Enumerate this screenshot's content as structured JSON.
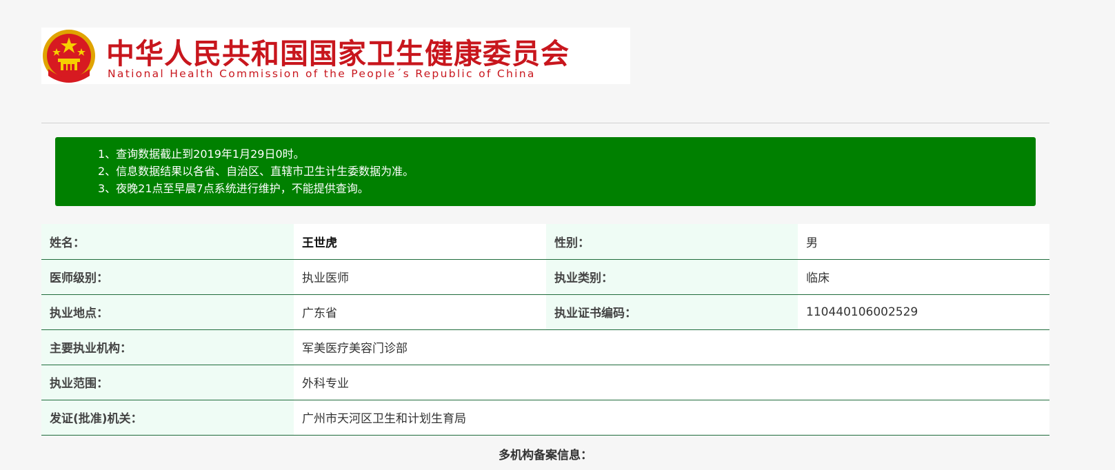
{
  "header": {
    "title_cn": "中华人民共和国国家卫生健康委员会",
    "title_en": "National Health Commission of the People´s Republic of China",
    "emblem_icon": "national-emblem-icon",
    "brand_color": "#c8161d"
  },
  "notice": {
    "background_color": "#008000",
    "lines": [
      "1、查询数据截止到2019年1月29日0时。",
      "2、信息数据结果以各省、自治区、直辖市卫生计生委数据为准。",
      "3、夜晚21点至早晨7点系统进行维护，不能提供查询。"
    ]
  },
  "record": {
    "name_label": "姓名：",
    "name_value": "王世虎",
    "gender_label": "性别：",
    "gender_value": "男",
    "level_label": "医师级别：",
    "level_value": "执业医师",
    "category_label": "执业类别：",
    "category_value": "临床",
    "location_label": "执业地点：",
    "location_value": "广东省",
    "cert_label": "执业证书编码：",
    "cert_value": "110440106002529",
    "institution_label": "主要执业机构：",
    "institution_value": "军美医疗美容门诊部",
    "scope_label": "执业范围：",
    "scope_value": "外科专业",
    "issuer_label": "发证(批准)机关：",
    "issuer_value": "广州市天河区卫生和计划生育局"
  },
  "multi_org": {
    "title": "多机构备案信息："
  }
}
